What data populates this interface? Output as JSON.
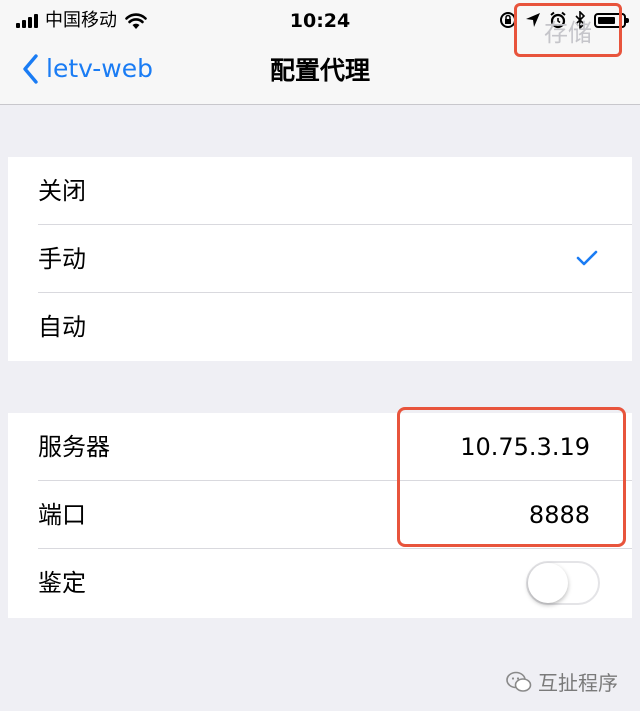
{
  "status_bar": {
    "carrier": "中国移动",
    "time": "10:24",
    "battery_level": 0.7,
    "icons": [
      "signal-icon",
      "wifi-icon",
      "orientation-lock-icon",
      "location-icon",
      "alarm-icon",
      "bluetooth-icon",
      "battery-icon"
    ]
  },
  "nav": {
    "back_label": "letv-web",
    "title": "配置代理",
    "save_label": "存储"
  },
  "proxy_modes": [
    {
      "label": "关闭",
      "selected": false
    },
    {
      "label": "手动",
      "selected": true
    },
    {
      "label": "自动",
      "selected": false
    }
  ],
  "server_settings": {
    "server_label": "服务器",
    "server_value": "10.75.3.19",
    "port_label": "端口",
    "port_value": "8888",
    "auth_label": "鉴定",
    "auth_enabled": false
  },
  "colors": {
    "accent": "#1a7cf4",
    "highlight": "#e8543c",
    "background": "#efeff4"
  },
  "watermark": {
    "text": "互扯程序"
  }
}
